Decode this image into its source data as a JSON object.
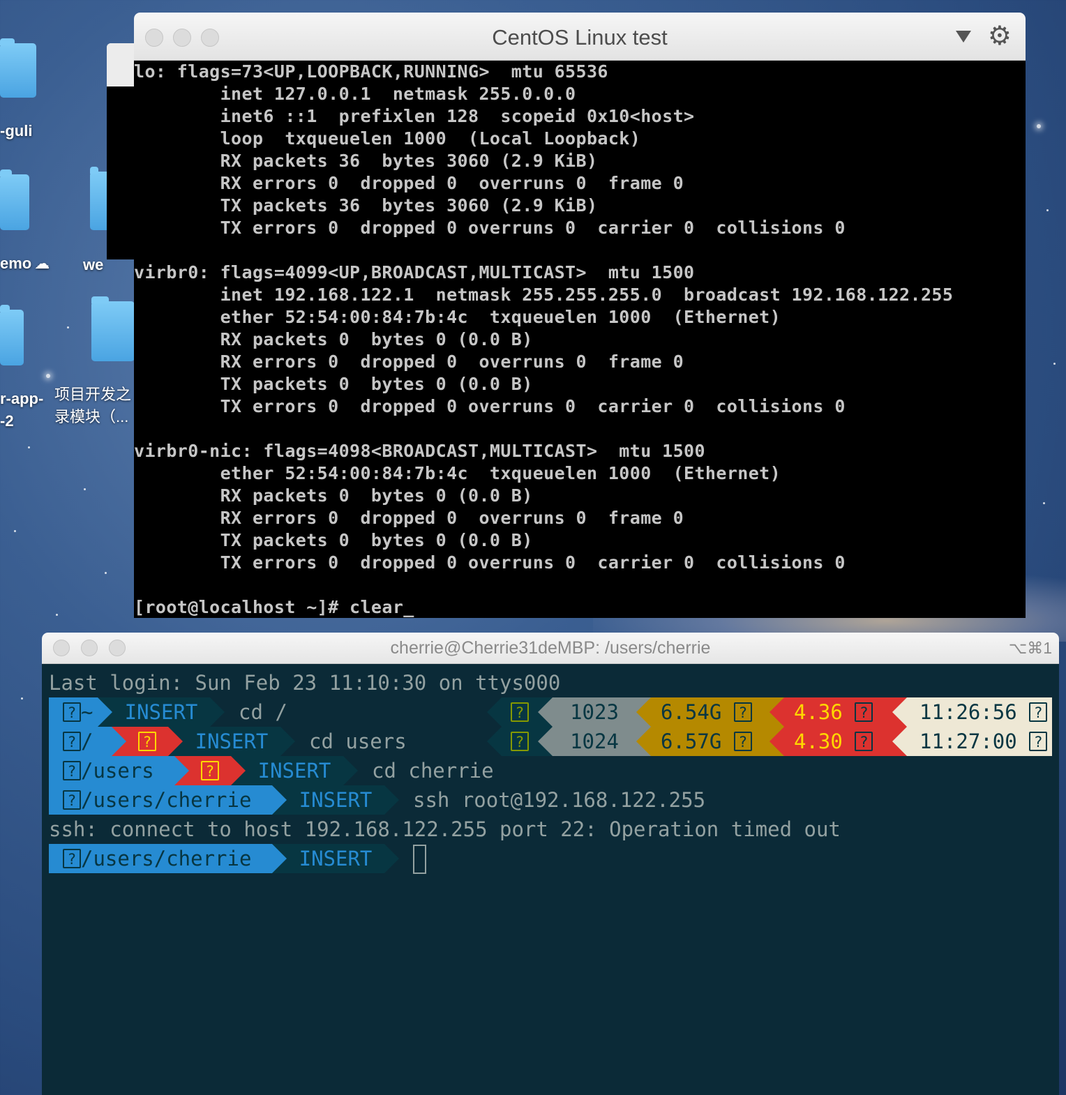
{
  "desktop": {
    "labels": [
      "-guli",
      "emo",
      "we",
      "r-app-",
      "-2",
      "项目开发之",
      "录模块（..."
    ],
    "cloud": "☁"
  },
  "centos": {
    "title": "CentOS Linux test",
    "lines": [
      "lo: flags=73<UP,LOOPBACK,RUNNING>  mtu 65536",
      "        inet 127.0.0.1  netmask 255.0.0.0",
      "        inet6 ::1  prefixlen 128  scopeid 0x10<host>",
      "        loop  txqueuelen 1000  (Local Loopback)",
      "        RX packets 36  bytes 3060 (2.9 KiB)",
      "        RX errors 0  dropped 0  overruns 0  frame 0",
      "        TX packets 36  bytes 3060 (2.9 KiB)",
      "        TX errors 0  dropped 0 overruns 0  carrier 0  collisions 0",
      "",
      "virbr0: flags=4099<UP,BROADCAST,MULTICAST>  mtu 1500",
      "        inet 192.168.122.1  netmask 255.255.255.0  broadcast 192.168.122.255",
      "        ether 52:54:00:84:7b:4c  txqueuelen 1000  (Ethernet)",
      "        RX packets 0  bytes 0 (0.0 B)",
      "        RX errors 0  dropped 0  overruns 0  frame 0",
      "        TX packets 0  bytes 0 (0.0 B)",
      "        TX errors 0  dropped 0 overruns 0  carrier 0  collisions 0",
      "",
      "virbr0-nic: flags=4098<BROADCAST,MULTICAST>  mtu 1500",
      "        ether 52:54:00:84:7b:4c  txqueuelen 1000  (Ethernet)",
      "        RX packets 0  bytes 0 (0.0 B)",
      "        RX errors 0  dropped 0  overruns 0  frame 0",
      "        TX packets 0  bytes 0 (0.0 B)",
      "        TX errors 0  dropped 0 overruns 0  carrier 0  collisions 0",
      "",
      "[root@localhost ~]# clear_"
    ]
  },
  "terminal": {
    "title": "cherrie@Cherrie31deMBP: /users/cherrie",
    "shortcut": "⌥⌘1",
    "last_login": "Last login: Sun Feb 23 11:10:30 on ttys000",
    "mode": "INSERT",
    "q": "?",
    "prompts": [
      {
        "path": "~",
        "cmd": "cd /"
      },
      {
        "path": "/",
        "cmd": "cd users"
      },
      {
        "path": "/users",
        "cmd": "cd cherrie"
      },
      {
        "path": "/users/cherrie",
        "cmd": "ssh root@192.168.122.255"
      }
    ],
    "error": "ssh: connect to host 192.168.122.255 port 22: Operation timed out",
    "final_path": "/users/cherrie",
    "status": [
      {
        "num": "1023",
        "mem": "6.54G",
        "load": "4.36",
        "time": "11:26:56"
      },
      {
        "num": "1024",
        "mem": "6.57G",
        "load": "4.30",
        "time": "11:27:00"
      }
    ]
  },
  "colors": {
    "blue": "#268bd2",
    "red": "#dc322f",
    "yellow": "#ffd700",
    "gold": "#b58900",
    "gray": "#93a1a1",
    "cream": "#eee8d5",
    "dark": "#073642",
    "bg": "#0b2a37"
  }
}
